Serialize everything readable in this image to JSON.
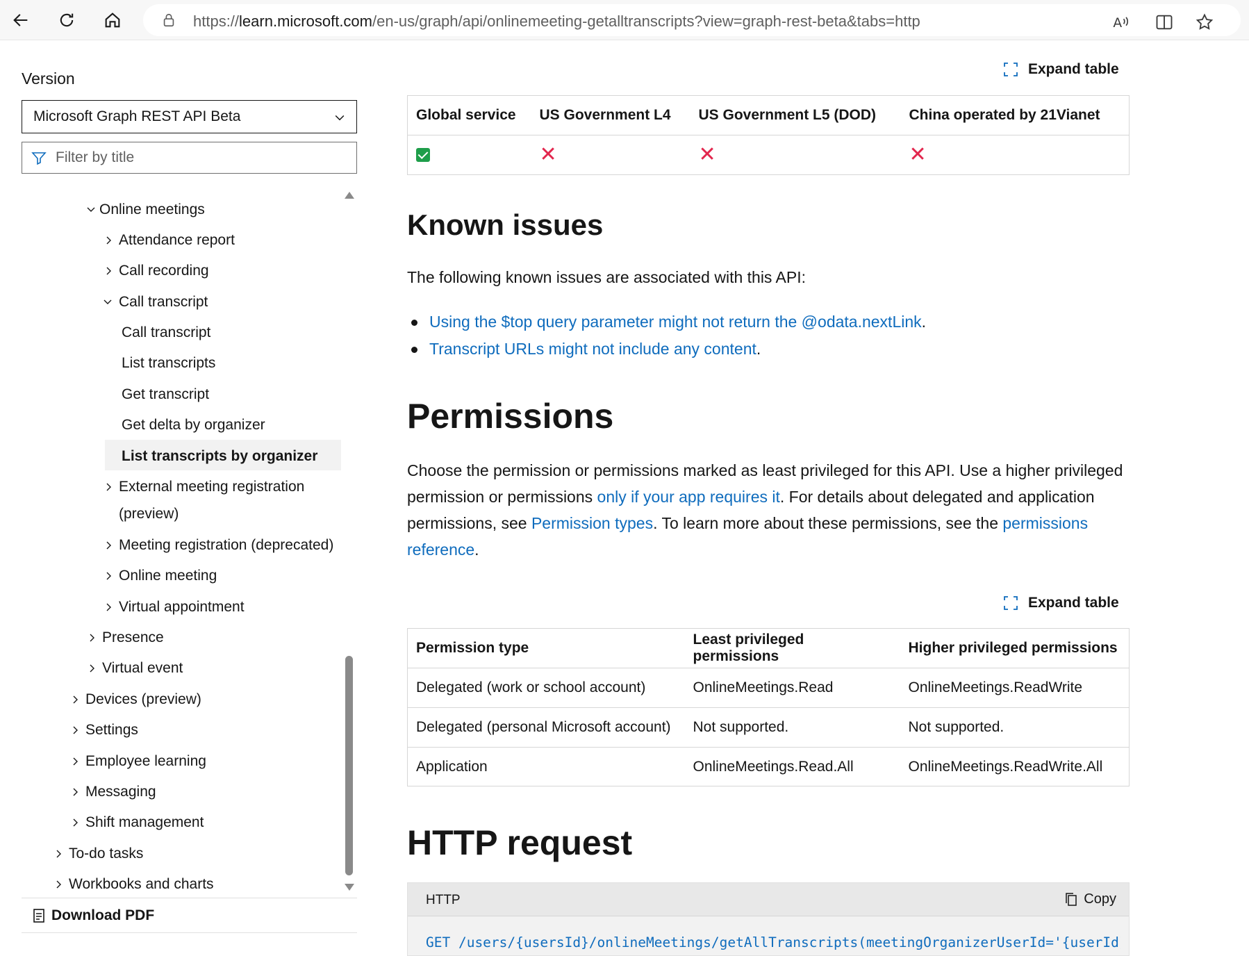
{
  "browser": {
    "url_prefix": "https://",
    "url_host": "learn.microsoft.com",
    "url_path": "/en-us/graph/api/onlinemeeting-getalltranscripts?view=graph-rest-beta&tabs=http"
  },
  "sidebar": {
    "version_label": "Version",
    "version_value": "Microsoft Graph REST API Beta",
    "filter_placeholder": "Filter by title",
    "toc": [
      {
        "label": "Online meetings",
        "expanded": true
      },
      {
        "label": "Attendance report",
        "expanded": false
      },
      {
        "label": "Call recording",
        "expanded": false
      },
      {
        "label": "Call transcript",
        "expanded": true
      },
      {
        "label": "Call transcript"
      },
      {
        "label": "List transcripts"
      },
      {
        "label": "Get transcript"
      },
      {
        "label": "Get delta by organizer"
      },
      {
        "label": "List transcripts by organizer",
        "selected": true
      },
      {
        "label": "External meeting registration",
        "expanded": false
      },
      {
        "label": "(preview)"
      },
      {
        "label": "Meeting registration (deprecated)",
        "expanded": false
      },
      {
        "label": "Online meeting",
        "expanded": false
      },
      {
        "label": "Virtual appointment",
        "expanded": false
      },
      {
        "label": "Presence",
        "expanded": false
      },
      {
        "label": "Virtual event",
        "expanded": false
      },
      {
        "label": "Devices (preview)",
        "expanded": false
      },
      {
        "label": "Settings",
        "expanded": false
      },
      {
        "label": "Employee learning",
        "expanded": false
      },
      {
        "label": "Messaging",
        "expanded": false
      },
      {
        "label": "Shift management",
        "expanded": false
      },
      {
        "label": "To-do tasks",
        "expanded": false
      },
      {
        "label": "Workbooks and charts",
        "expanded": false
      }
    ],
    "download_pdf": "Download PDF"
  },
  "availability_table": {
    "expand_label": "Expand table",
    "headers": [
      "Global service",
      "US Government L4",
      "US Government L5 (DOD)",
      "China operated by 21Vianet"
    ],
    "values": [
      "supported",
      "not-supported",
      "not-supported",
      "not-supported"
    ]
  },
  "known_issues": {
    "heading": "Known issues",
    "intro": "The following known issues are associated with this API:",
    "items": [
      {
        "link": "Using the $top query parameter might not return the @odata.nextLink",
        "suffix": "."
      },
      {
        "link": "Transcript URLs might not include any content",
        "suffix": "."
      }
    ]
  },
  "permissions": {
    "heading": "Permissions",
    "p1": "Choose the permission or permissions marked as least privileged for this API. Use a higher privileged permission or permissions ",
    "link1": "only if your app requires it",
    "p2": ". For details about delegated and application permissions, see ",
    "link2": "Permission types",
    "p3": ". To learn more about these permissions, see the ",
    "link3": "permissions reference",
    "p4": ".",
    "expand_label": "Expand table",
    "headers": [
      "Permission type",
      "Least privileged permissions",
      "Higher privileged permissions"
    ],
    "rows": [
      [
        "Delegated (work or school account)",
        "OnlineMeetings.Read",
        "OnlineMeetings.ReadWrite"
      ],
      [
        "Delegated (personal Microsoft account)",
        "Not supported.",
        "Not supported."
      ],
      [
        "Application",
        "OnlineMeetings.Read.All",
        "OnlineMeetings.ReadWrite.All"
      ]
    ]
  },
  "http_request": {
    "heading": "HTTP request",
    "lang": "HTTP",
    "copy_label": "Copy",
    "code": "GET /users/{usersId}/onlineMeetings/getAllTranscripts(meetingOrganizerUserId='{userId}',"
  },
  "colors": {
    "link": "#0f6cbd",
    "check": "#1e9e4a",
    "cross": "#e2264d"
  }
}
